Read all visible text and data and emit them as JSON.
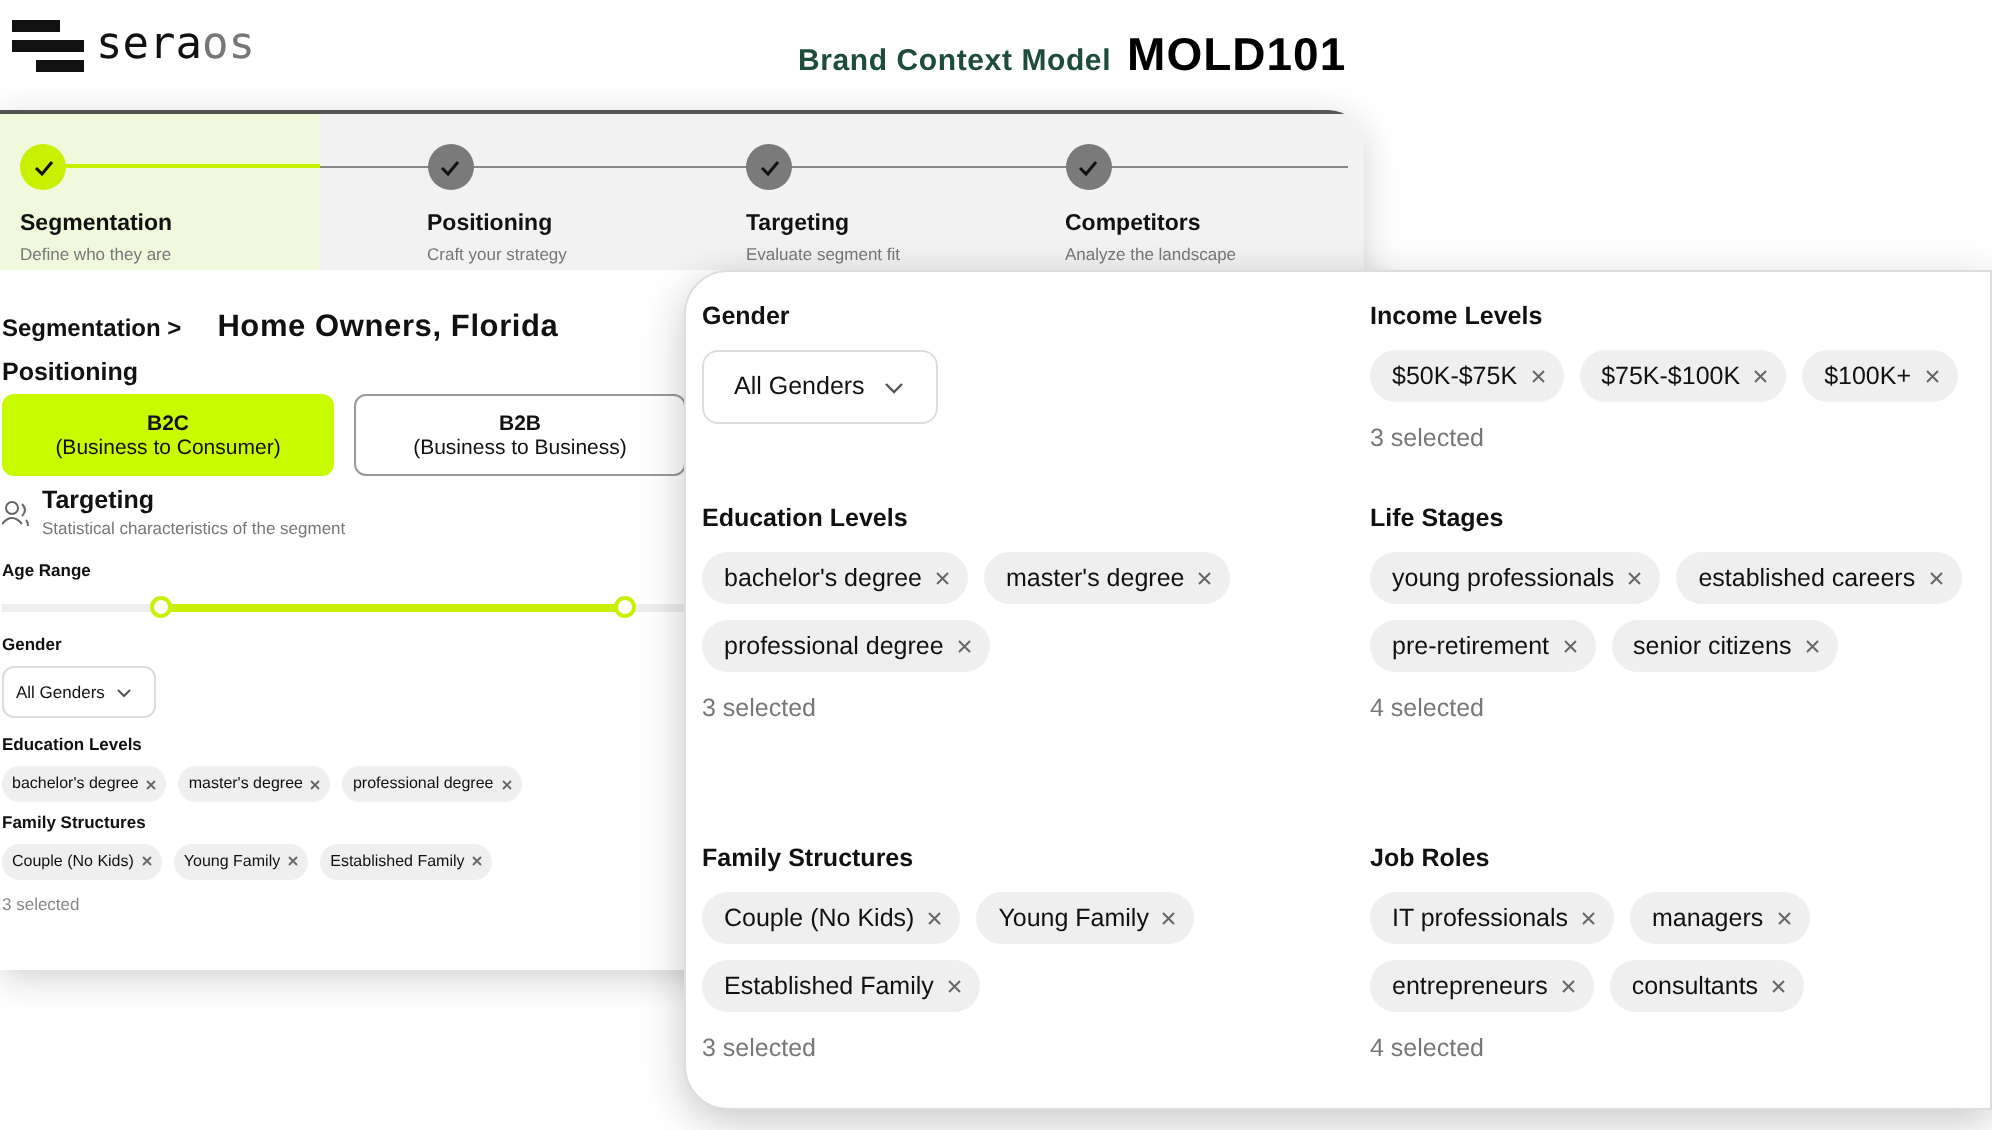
{
  "header": {
    "logo": {
      "main": "sera",
      "accent": "os"
    },
    "title": "Brand Context Model",
    "code": "MOLD101"
  },
  "back_card": {
    "steps": [
      {
        "title": "Segmentation",
        "subtitle": "Define who they are",
        "selected": true,
        "done": true
      },
      {
        "title": "Positioning",
        "subtitle": "Craft your strategy",
        "selected": false,
        "done": true
      },
      {
        "title": "Targeting",
        "subtitle": "Evaluate segment fit",
        "selected": false,
        "done": true
      },
      {
        "title": "Competitors",
        "subtitle": "Analyze the landscape",
        "selected": false,
        "done": true
      }
    ],
    "breadcrumb": {
      "section": "Segmentation",
      "separator": ">",
      "segment": "Home Owners, Florida"
    },
    "positioning": {
      "label": "Positioning",
      "options": [
        {
          "title": "B2C",
          "subtitle": "(Business to Consumer)",
          "selected": true
        },
        {
          "title": "B2B",
          "subtitle": "(Business to Business)",
          "selected": false
        }
      ]
    },
    "targeting": {
      "title": "Targeting",
      "subtitle": "Statistical characteristics of the segment"
    },
    "age_range": {
      "label": "Age Range",
      "start": {
        "level": 0.23
      },
      "end": {
        "level": 0.9
      }
    },
    "gender": {
      "label": "Gender",
      "value": "All Genders"
    },
    "education": {
      "label": "Education Levels",
      "chips": [
        "bachelor's degree",
        "master's degree",
        "professional degree"
      ]
    },
    "family": {
      "label": "Family Structures",
      "chips": [
        "Couple (No Kids)",
        "Young Family",
        "Established Family"
      ],
      "count": "3 selected"
    }
  },
  "front_card": {
    "sections": [
      {
        "kind": "dropdown",
        "label": "Gender",
        "value": "All Genders"
      },
      {
        "kind": "chips",
        "label": "Education Levels",
        "chips": [
          "bachelor's degree",
          "master's degree",
          "professional degree"
        ],
        "count": "3 selected"
      },
      {
        "kind": "chips",
        "label": "Family Structures",
        "chips": [
          "Couple (No Kids)",
          "Young Family",
          "Established Family"
        ],
        "count": "3 selected"
      },
      {
        "kind": "chips",
        "label": "Income Levels",
        "chips": [
          "$50K-$75K",
          "$75K-$100K",
          "$100K+"
        ],
        "count": "3 selected"
      },
      {
        "kind": "chips",
        "label": "Life Stages",
        "chips": [
          "young professionals",
          "established careers",
          "pre-retirement",
          "senior citizens"
        ],
        "count": "4 selected"
      },
      {
        "kind": "chips",
        "label": "Job Roles",
        "chips": [
          "IT professionals",
          "managers",
          "entrepreneurs",
          "consultants"
        ],
        "count": "4 selected"
      }
    ]
  }
}
